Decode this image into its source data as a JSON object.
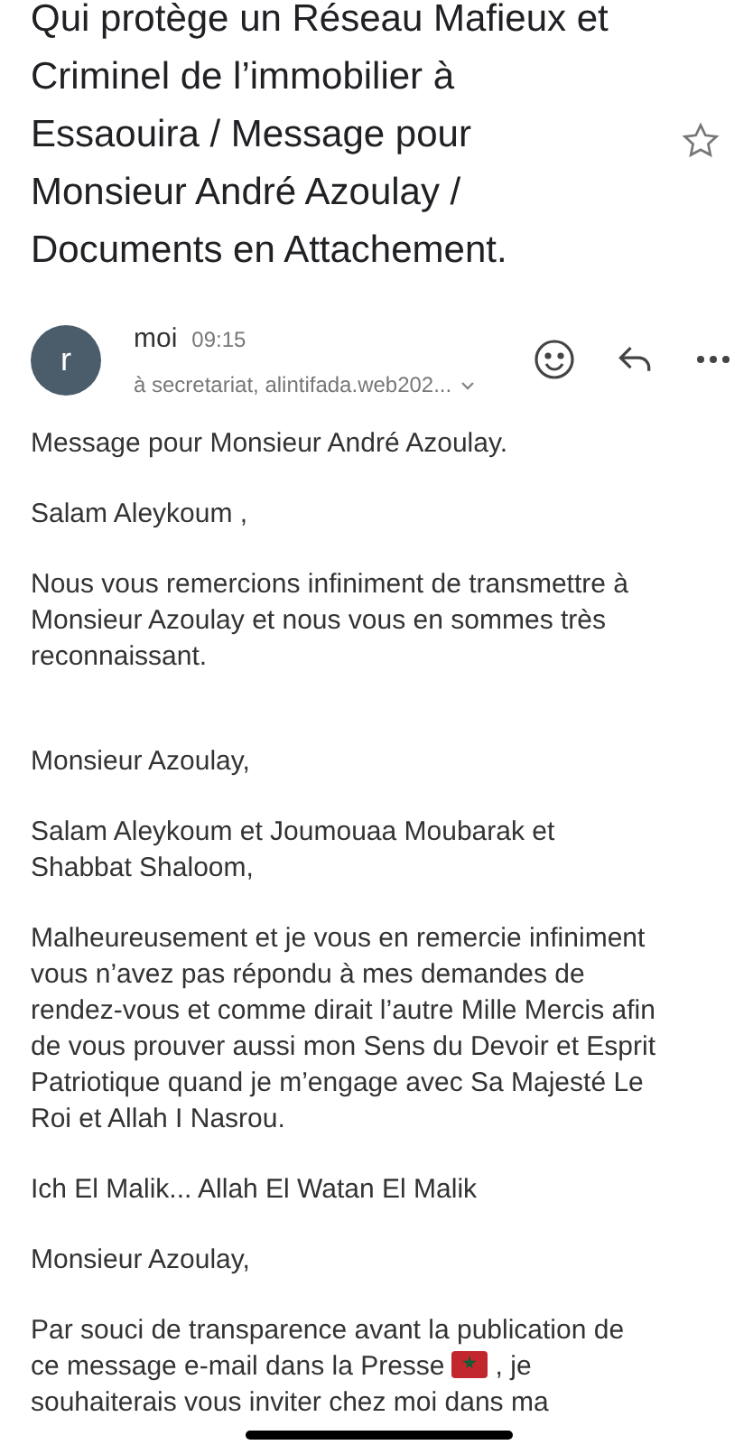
{
  "subject": "Qui protège un Réseau Mafieux et Criminel de l’immobilier à Essaouira / Message pour Monsieur André Azoulay / Documents en Attachement.",
  "starred": false,
  "sender": {
    "avatar_letter": "r",
    "name": "moi",
    "time": "09:15",
    "recipients": "à secretariat, alintifada.web202..."
  },
  "body": [
    {
      "kind": "text",
      "text": "Message pour Monsieur André Azoulay."
    },
    {
      "kind": "text",
      "text": "Salam Aleykoum ,"
    },
    {
      "kind": "text",
      "text": "Nous vous remercions infiniment de transmettre à Monsieur Azoulay et nous vous en sommes très reconnaissant."
    },
    {
      "kind": "spacer"
    },
    {
      "kind": "text",
      "text": "Monsieur Azoulay,"
    },
    {
      "kind": "text",
      "text": "Salam Aleykoum et Joumouaa Moubarak et Shabbat Shaloom,"
    },
    {
      "kind": "text",
      "text": "Malheureusement et je vous en remercie infiniment vous n’avez pas répondu à mes demandes de rendez-vous et comme dirait l’autre Mille Mercis afin de vous prouver aussi mon Sens du Devoir et Esprit Patriotique quand je m’engage avec Sa Majesté Le Roi et Allah I Nasrou."
    },
    {
      "kind": "text",
      "text": "Ich El Malik... Allah El Watan El Malik"
    },
    {
      "kind": "text",
      "text": "Monsieur Azoulay,"
    },
    {
      "kind": "flag_text",
      "before": "Par souci de transparence avant la publication de ce message e-mail dans la Presse",
      "after": ", je souhaiterais vous inviter chez moi dans ma"
    }
  ]
}
